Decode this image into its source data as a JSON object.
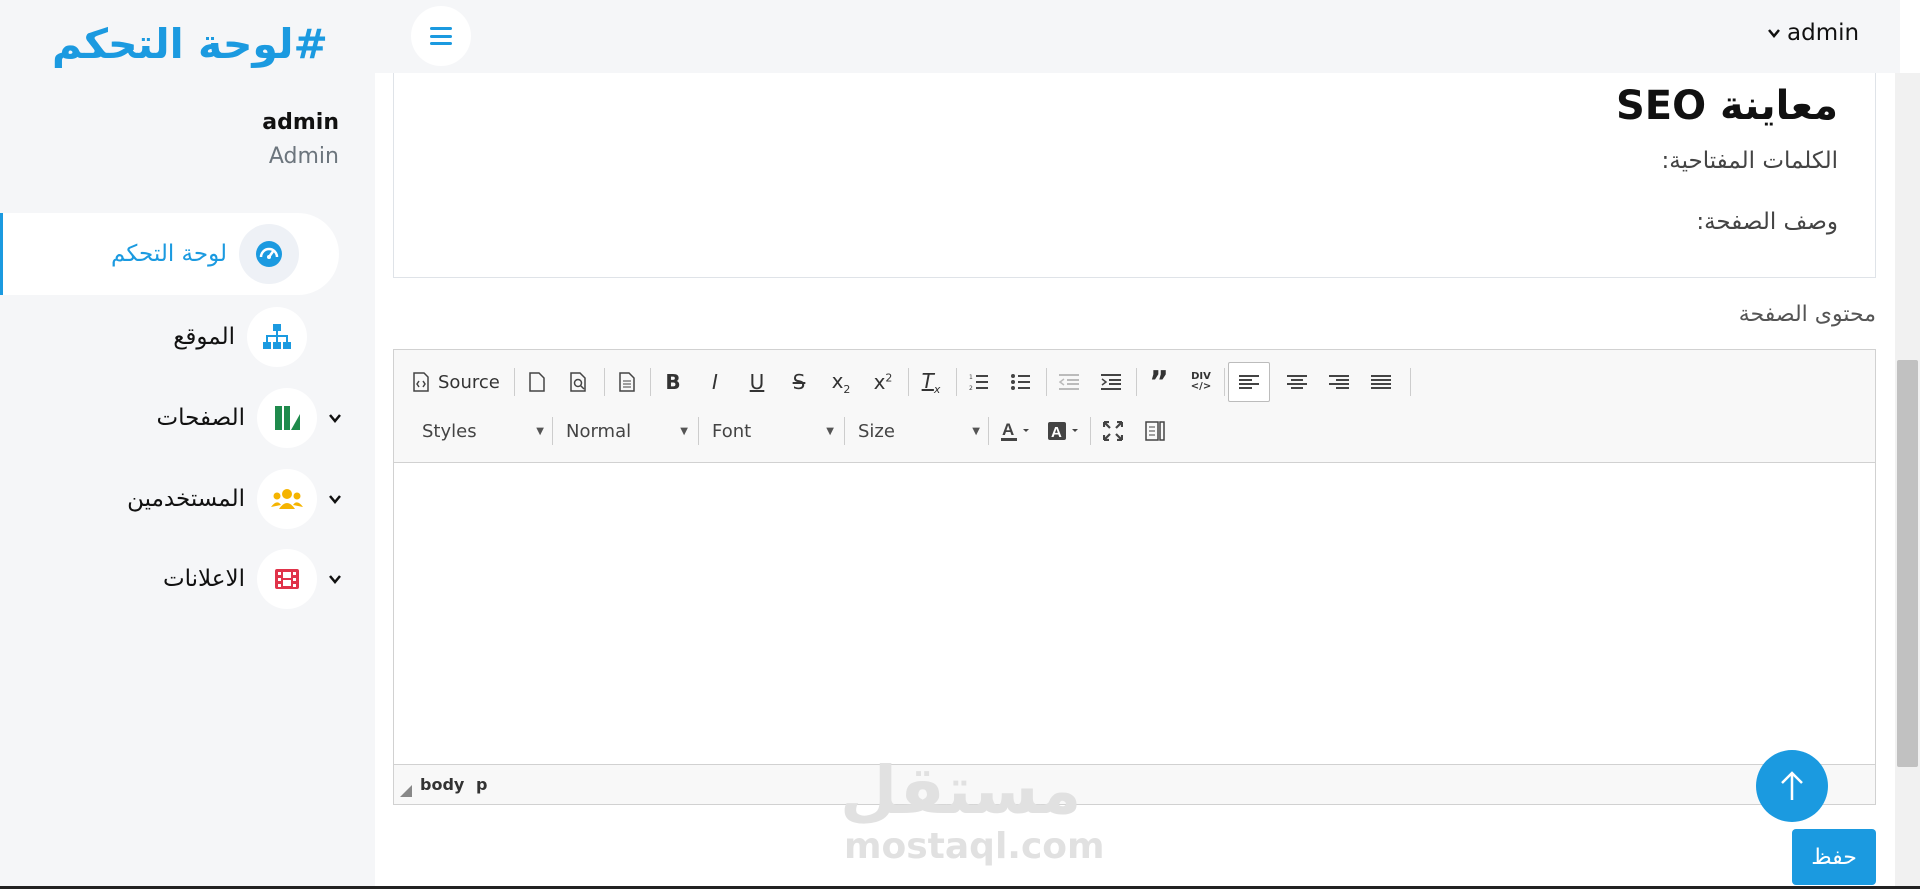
{
  "brand": "#لوحة التحكم",
  "user": {
    "name": "admin",
    "role": "Admin"
  },
  "sidebar": {
    "items": [
      {
        "label": "لوحة التحكم",
        "icon": "dashboard-icon",
        "active": true
      },
      {
        "label": "الموقع",
        "icon": "sitemap-icon",
        "active": false
      },
      {
        "label": "الصفحات",
        "icon": "pages-icon",
        "active": false,
        "expandable": true
      },
      {
        "label": "المستخدمين",
        "icon": "users-icon",
        "active": false,
        "expandable": true
      },
      {
        "label": "الاعلانات",
        "icon": "film-icon",
        "active": false,
        "expandable": true
      }
    ]
  },
  "topbar": {
    "user_menu": "admin",
    "menu_icon": "hamburger-icon"
  },
  "seo": {
    "title": "معاينة SEO",
    "keywords_label": "الكلمات المفتاحية:",
    "description_label": "وصف الصفحة:"
  },
  "content": {
    "label": "محتوى الصفحة"
  },
  "editor": {
    "source_label": "Source",
    "styles": "Styles",
    "format": "Normal",
    "font": "Font",
    "size": "Size",
    "path": [
      "body",
      "p"
    ]
  },
  "save_label": "حفظ",
  "watermark": {
    "arabic": "مستقل",
    "latin": "mostaql.com"
  },
  "colors": {
    "accent": "#1b9ae0",
    "sidebar_bg": "#f5f6f8"
  }
}
